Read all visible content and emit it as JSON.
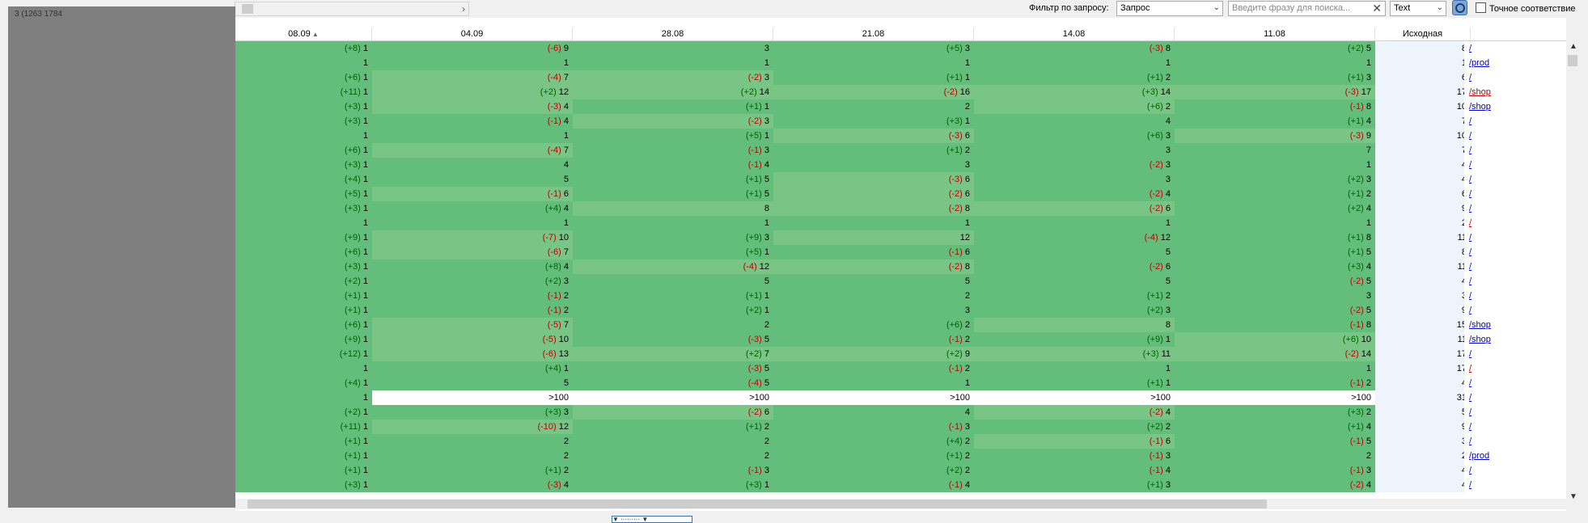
{
  "left_panel": {
    "text": "3        (1263        1784"
  },
  "toolbar": {
    "filter_label": "Фильтр по запросу:",
    "filter_select": "Запрос",
    "search_placeholder": "Введите фразу для поиска...",
    "type_select": "Text",
    "exact_label": "Точное соответствие"
  },
  "columns": [
    "08.09",
    "04.09",
    "28.08",
    "21.08",
    "14.08",
    "11.08",
    "Исходная"
  ],
  "rows": [
    {
      "d": [
        [
          "+8",
          "1"
        ],
        [
          "-6",
          "9"
        ],
        [
          "",
          "3"
        ],
        [
          "+5",
          "3"
        ],
        [
          "-3",
          "8"
        ],
        [
          "+2",
          "5"
        ]
      ],
      "src": "8",
      "url": "/",
      "hl": [
        0,
        0,
        0,
        0,
        0,
        0
      ]
    },
    {
      "d": [
        [
          "",
          "1"
        ],
        [
          "",
          "1"
        ],
        [
          "",
          "1"
        ],
        [
          "",
          "1"
        ],
        [
          "",
          "1"
        ],
        [
          "",
          "1"
        ]
      ],
      "src": "1",
      "url": "/prod",
      "hl": [
        0,
        0,
        0,
        0,
        0,
        0
      ]
    },
    {
      "d": [
        [
          "+6",
          "1"
        ],
        [
          "-4",
          "7"
        ],
        [
          "-2",
          "3"
        ],
        [
          "+1",
          "1"
        ],
        [
          "+1",
          "2"
        ],
        [
          "+1",
          "3"
        ]
      ],
      "src": "6",
      "url": "/",
      "hl": [
        0,
        1,
        1,
        0,
        0,
        0
      ]
    },
    {
      "d": [
        [
          "+11",
          "1"
        ],
        [
          "+2",
          "12"
        ],
        [
          "+2",
          "14"
        ],
        [
          "-2",
          "16"
        ],
        [
          "+3",
          "14"
        ],
        [
          "-3",
          "17"
        ]
      ],
      "src": "17",
      "url": "/shop",
      "red": true,
      "hl": [
        0,
        1,
        1,
        1,
        1,
        1
      ]
    },
    {
      "d": [
        [
          "+3",
          "1"
        ],
        [
          "-3",
          "4"
        ],
        [
          "+1",
          "1"
        ],
        [
          "",
          "2"
        ],
        [
          "+6",
          "2"
        ],
        [
          "-1",
          "8"
        ]
      ],
      "src": "10",
      "url": "/shop",
      "hl": [
        0,
        1,
        0,
        0,
        1,
        0
      ]
    },
    {
      "d": [
        [
          "+3",
          "1"
        ],
        [
          "-1",
          "4"
        ],
        [
          "-2",
          "3"
        ],
        [
          "+3",
          "1"
        ],
        [
          "",
          "4"
        ],
        [
          "+1",
          "4"
        ]
      ],
      "src": "7",
      "url": "/",
      "hl": [
        0,
        0,
        1,
        0,
        0,
        0
      ]
    },
    {
      "d": [
        [
          "",
          "1"
        ],
        [
          "",
          "1"
        ],
        [
          "+5",
          "1"
        ],
        [
          "-3",
          "6"
        ],
        [
          "+6",
          "3"
        ],
        [
          "-3",
          "9"
        ]
      ],
      "src": "10",
      "url": "/",
      "hl": [
        0,
        0,
        0,
        1,
        0,
        1
      ]
    },
    {
      "d": [
        [
          "+6",
          "1"
        ],
        [
          "-4",
          "7"
        ],
        [
          "-1",
          "3"
        ],
        [
          "+1",
          "2"
        ],
        [
          "",
          "3"
        ],
        [
          "",
          "7"
        ]
      ],
      "src": "7",
      "url": "/",
      "hl": [
        0,
        1,
        0,
        0,
        0,
        0
      ]
    },
    {
      "d": [
        [
          "+3",
          "1"
        ],
        [
          "",
          "4"
        ],
        [
          "-1",
          "4"
        ],
        [
          "",
          "3"
        ],
        [
          "-2",
          "3"
        ],
        [
          "",
          "1"
        ]
      ],
      "src": "4",
      "url": "/",
      "hl": [
        0,
        0,
        0,
        0,
        0,
        0
      ]
    },
    {
      "d": [
        [
          "+4",
          "1"
        ],
        [
          "",
          "5"
        ],
        [
          "+1",
          "5"
        ],
        [
          "-3",
          "6"
        ],
        [
          "",
          "3"
        ],
        [
          "+2",
          "3"
        ]
      ],
      "src": "4",
      "url": "/",
      "hl": [
        0,
        0,
        0,
        1,
        0,
        0
      ]
    },
    {
      "d": [
        [
          "+5",
          "1"
        ],
        [
          "-1",
          "6"
        ],
        [
          "+1",
          "5"
        ],
        [
          "-2",
          "6"
        ],
        [
          "-2",
          "4"
        ],
        [
          "+1",
          "2"
        ]
      ],
      "src": "6",
      "url": "/",
      "hl": [
        0,
        1,
        0,
        1,
        0,
        0
      ]
    },
    {
      "d": [
        [
          "+3",
          "1"
        ],
        [
          "+4",
          "4"
        ],
        [
          "",
          "8"
        ],
        [
          "-2",
          "8"
        ],
        [
          "-2",
          "6"
        ],
        [
          "+2",
          "4"
        ]
      ],
      "src": "9",
      "url": "/",
      "hl": [
        0,
        0,
        1,
        1,
        1,
        0
      ]
    },
    {
      "d": [
        [
          "",
          "1"
        ],
        [
          "",
          "1"
        ],
        [
          "",
          "1"
        ],
        [
          "",
          "1"
        ],
        [
          "",
          "1"
        ],
        [
          "",
          "1"
        ]
      ],
      "src": "2",
      "url": "/",
      "red": true,
      "hl": [
        0,
        0,
        0,
        0,
        0,
        0
      ]
    },
    {
      "d": [
        [
          "+9",
          "1"
        ],
        [
          "-7",
          "10"
        ],
        [
          "+9",
          "3"
        ],
        [
          "",
          "12"
        ],
        [
          "-4",
          "12"
        ],
        [
          "+1",
          "8"
        ]
      ],
      "src": "11",
      "url": "/",
      "hl": [
        0,
        1,
        0,
        1,
        0,
        0
      ]
    },
    {
      "d": [
        [
          "+6",
          "1"
        ],
        [
          "-6",
          "7"
        ],
        [
          "+5",
          "1"
        ],
        [
          "-1",
          "6"
        ],
        [
          "",
          "5"
        ],
        [
          "+1",
          "5"
        ]
      ],
      "src": "8",
      "url": "/",
      "hl": [
        0,
        1,
        0,
        0,
        0,
        0
      ]
    },
    {
      "d": [
        [
          "+3",
          "1"
        ],
        [
          "+8",
          "4"
        ],
        [
          "-4",
          "12"
        ],
        [
          "-2",
          "8"
        ],
        [
          "-2",
          "6"
        ],
        [
          "+3",
          "4"
        ]
      ],
      "src": "11",
      "url": "/",
      "hl": [
        0,
        0,
        1,
        1,
        0,
        0
      ]
    },
    {
      "d": [
        [
          "+2",
          "1"
        ],
        [
          "+2",
          "3"
        ],
        [
          "",
          "5"
        ],
        [
          "",
          "5"
        ],
        [
          "",
          "5"
        ],
        [
          "-2",
          "5"
        ]
      ],
      "src": "4",
      "url": "/",
      "hl": [
        0,
        0,
        0,
        0,
        0,
        0
      ]
    },
    {
      "d": [
        [
          "+1",
          "1"
        ],
        [
          "-1",
          "2"
        ],
        [
          "+1",
          "1"
        ],
        [
          "",
          "2"
        ],
        [
          "+1",
          "2"
        ],
        [
          "",
          "3"
        ]
      ],
      "src": "3",
      "url": "/",
      "hl": [
        0,
        0,
        0,
        0,
        0,
        0
      ]
    },
    {
      "d": [
        [
          "+1",
          "1"
        ],
        [
          "-1",
          "2"
        ],
        [
          "+2",
          "1"
        ],
        [
          "",
          "3"
        ],
        [
          "+2",
          "3"
        ],
        [
          "-2",
          "5"
        ]
      ],
      "src": "9",
      "url": "/",
      "hl": [
        0,
        0,
        0,
        0,
        0,
        0
      ]
    },
    {
      "d": [
        [
          "+6",
          "1"
        ],
        [
          "-5",
          "7"
        ],
        [
          "",
          "2"
        ],
        [
          "+6",
          "2"
        ],
        [
          "",
          "8"
        ],
        [
          "-1",
          "8"
        ]
      ],
      "src": "15",
      "url": "/shop",
      "hl": [
        0,
        1,
        0,
        0,
        1,
        0
      ]
    },
    {
      "d": [
        [
          "+9",
          "1"
        ],
        [
          "-5",
          "10"
        ],
        [
          "-3",
          "5"
        ],
        [
          "-1",
          "2"
        ],
        [
          "+9",
          "1"
        ],
        [
          "+6",
          "10"
        ]
      ],
      "src": "11",
      "url": "/shop",
      "hl": [
        0,
        1,
        0,
        0,
        0,
        1
      ]
    },
    {
      "d": [
        [
          "+12",
          "1"
        ],
        [
          "-6",
          "13"
        ],
        [
          "+2",
          "7"
        ],
        [
          "+2",
          "9"
        ],
        [
          "+3",
          "11"
        ],
        [
          "-2",
          "14"
        ]
      ],
      "src": "17",
      "url": "/",
      "hl": [
        0,
        1,
        1,
        1,
        1,
        1
      ]
    },
    {
      "d": [
        [
          "",
          "1"
        ],
        [
          "+4",
          "1"
        ],
        [
          "-3",
          "5"
        ],
        [
          "-1",
          "2"
        ],
        [
          "",
          "1"
        ],
        [
          "",
          "1"
        ]
      ],
      "src": "17",
      "url": "/",
      "red": true,
      "hl": [
        0,
        0,
        0,
        0,
        0,
        0
      ]
    },
    {
      "d": [
        [
          "+4",
          "1"
        ],
        [
          "",
          "5"
        ],
        [
          "-4",
          "5"
        ],
        [
          "",
          "1"
        ],
        [
          "+1",
          "1"
        ],
        [
          "-1",
          "2"
        ]
      ],
      "src": "4",
      "url": "/",
      "hl": [
        0,
        0,
        0,
        0,
        0,
        0
      ]
    },
    {
      "d": [
        [
          "",
          "1"
        ],
        [
          "",
          ">100"
        ],
        [
          "",
          ">100"
        ],
        [
          "",
          ">100"
        ],
        [
          "",
          ">100"
        ],
        [
          "",
          ">100"
        ]
      ],
      "src": "31",
      "url": "/",
      "hl": [
        0,
        2,
        2,
        2,
        2,
        2
      ]
    },
    {
      "d": [
        [
          "+2",
          "1"
        ],
        [
          "+3",
          "3"
        ],
        [
          "-2",
          "6"
        ],
        [
          "",
          "4"
        ],
        [
          "-2",
          "4"
        ],
        [
          "+3",
          "2"
        ]
      ],
      "src": "5",
      "url": "/",
      "hl": [
        0,
        0,
        1,
        0,
        1,
        0
      ]
    },
    {
      "d": [
        [
          "+11",
          "1"
        ],
        [
          "-10",
          "12"
        ],
        [
          "+1",
          "2"
        ],
        [
          "-1",
          "3"
        ],
        [
          "+2",
          "2"
        ],
        [
          "+1",
          "4"
        ]
      ],
      "src": "9",
      "url": "/",
      "hl": [
        0,
        1,
        0,
        0,
        0,
        0
      ]
    },
    {
      "d": [
        [
          "+1",
          "1"
        ],
        [
          "",
          "2"
        ],
        [
          "",
          "2"
        ],
        [
          "+4",
          "2"
        ],
        [
          "-1",
          "6"
        ],
        [
          "-1",
          "5"
        ]
      ],
      "src": "3",
      "url": "/",
      "hl": [
        0,
        0,
        0,
        0,
        1,
        0
      ]
    },
    {
      "d": [
        [
          "+1",
          "1"
        ],
        [
          "",
          "2"
        ],
        [
          "",
          "2"
        ],
        [
          "+1",
          "2"
        ],
        [
          "-1",
          "3"
        ],
        [
          "",
          "2"
        ]
      ],
      "src": "2",
      "url": "/prod",
      "hl": [
        0,
        0,
        0,
        0,
        0,
        0
      ]
    },
    {
      "d": [
        [
          "+1",
          "1"
        ],
        [
          "+1",
          "2"
        ],
        [
          "-1",
          "3"
        ],
        [
          "+2",
          "2"
        ],
        [
          "-1",
          "4"
        ],
        [
          "-1",
          "3"
        ]
      ],
      "src": "4",
      "url": "/",
      "hl": [
        0,
        0,
        0,
        0,
        0,
        0
      ]
    },
    {
      "d": [
        [
          "+3",
          "1"
        ],
        [
          "-3",
          "4"
        ],
        [
          "+3",
          "1"
        ],
        [
          "-1",
          "4"
        ],
        [
          "+1",
          "3"
        ],
        [
          "-2",
          "4"
        ]
      ],
      "src": "4",
      "url": "/",
      "hl": [
        0,
        0,
        0,
        0,
        0,
        0
      ]
    }
  ]
}
